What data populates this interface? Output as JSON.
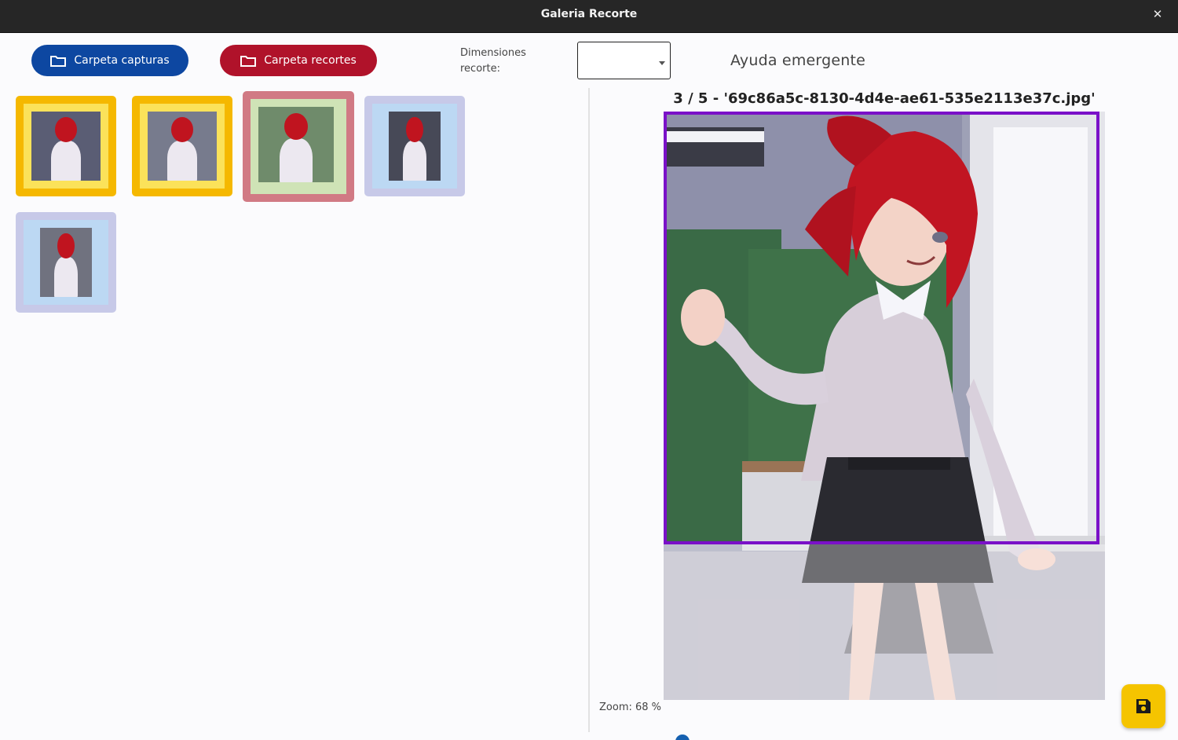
{
  "window": {
    "title": "Galeria Recorte",
    "close_glyph": "✕"
  },
  "toolbar": {
    "captures_button": {
      "label": "Carpeta capturas",
      "icon": "folder-icon",
      "color": "#0d47a1"
    },
    "crops_button": {
      "label": "Carpeta recortes",
      "icon": "folder-icon",
      "color": "#b0122a"
    },
    "dimensions_label": "Dimensiones recorte:",
    "dimensions_select": {
      "value": ""
    },
    "help_label": "Ayuda emergente"
  },
  "gallery": {
    "thumbnails": [
      {
        "state": "amarillo",
        "frame_color": "#f5b800",
        "selected": false
      },
      {
        "state": "amarillo",
        "frame_color": "#f5b800",
        "selected": false
      },
      {
        "state": "seleccionado",
        "frame_color": "#d17a84",
        "selected": true
      },
      {
        "state": "pendiente",
        "frame_color": "#c7c9e8",
        "selected": false
      },
      {
        "state": "pendiente",
        "frame_color": "#c7c9e8",
        "selected": false
      }
    ]
  },
  "viewer": {
    "caption": "3 / 5 - '69c86a5c-8130-4d4e-ae61-535e2113e37c.jpg'",
    "crop_color": "#7a10c8",
    "zoom_label": "Zoom: 68 %",
    "zoom_percent": 68
  },
  "fab": {
    "icon": "save-icon",
    "color": "#f5c400"
  }
}
